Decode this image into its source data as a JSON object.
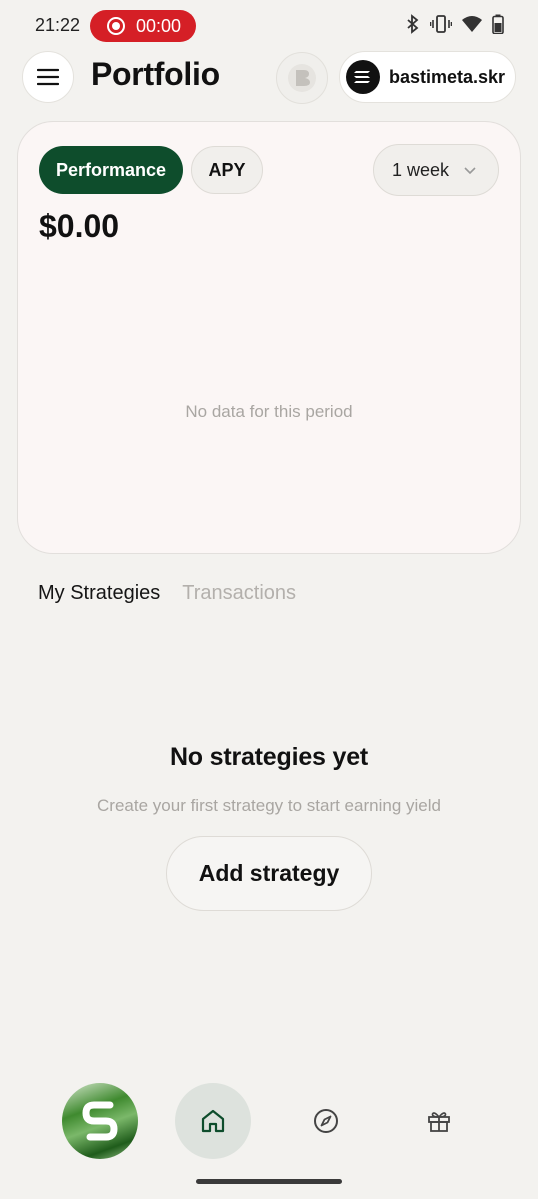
{
  "status_bar": {
    "time": "21:22",
    "recording_timer": "00:00",
    "icons": [
      "bluetooth-icon",
      "vibrate-icon",
      "wifi-icon",
      "battery-icon"
    ]
  },
  "header": {
    "title": "Portfolio",
    "wallet_name": "bastimeta.skr"
  },
  "card": {
    "tabs": [
      "Performance",
      "APY"
    ],
    "active_tab": "Performance",
    "period": "1 week",
    "balance": "$0.00",
    "empty_message": "No data for this period"
  },
  "sections": {
    "tabs": [
      "My Strategies",
      "Transactions"
    ],
    "active": "My Strategies"
  },
  "empty_state": {
    "title": "No strategies yet",
    "subtitle": "Create your first strategy to start earning yield",
    "button_label": "Add strategy"
  },
  "bottom_nav": {
    "items": [
      "avatar",
      "home-icon",
      "compass-icon",
      "gift-icon"
    ],
    "active": "home-icon"
  },
  "colors": {
    "background": "#f3f2ef",
    "accent": "#0e4d2c",
    "recording": "#d51f26",
    "muted_text": "#a9a6a2"
  }
}
